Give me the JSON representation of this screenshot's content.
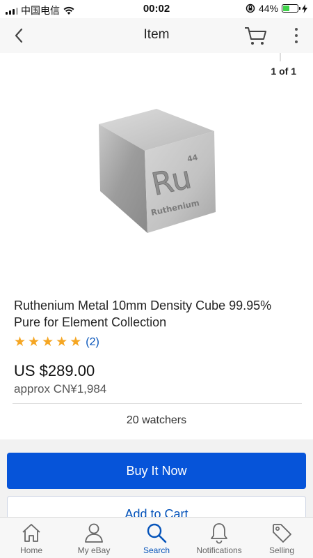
{
  "status_bar": {
    "carrier": "中国电信",
    "time": "00:02",
    "battery": "44%",
    "battery_level": 0.44
  },
  "nav": {
    "title": "Item",
    "back_icon": "chevron-left-icon",
    "cart_icon": "cart-icon",
    "more_icon": "more-vertical-icon"
  },
  "gallery": {
    "photo_count": "1 of 1",
    "image_symbol": "Ru",
    "image_number": "44",
    "image_name": "Ruthenium"
  },
  "listing": {
    "title": "Ruthenium Metal 10mm Density Cube 99.95% Pure for Element Collection",
    "rating_stars": 5,
    "rating_count": "(2)",
    "price": "US $289.00",
    "approx_price": "approx CN¥1,984",
    "watchers": "20 watchers"
  },
  "actions": {
    "buy_now": "Buy It Now",
    "add_to_cart": "Add to Cart"
  },
  "tabs": [
    {
      "label": "Home",
      "icon": "home-icon",
      "active": false
    },
    {
      "label": "My eBay",
      "icon": "person-icon",
      "active": false
    },
    {
      "label": "Search",
      "icon": "search-icon",
      "active": true
    },
    {
      "label": "Notifications",
      "icon": "bell-icon",
      "active": false
    },
    {
      "label": "Selling",
      "icon": "tag-icon",
      "active": false
    }
  ],
  "colors": {
    "accent": "#0654d9",
    "star": "#f5a623",
    "battery": "#3fd34a"
  }
}
